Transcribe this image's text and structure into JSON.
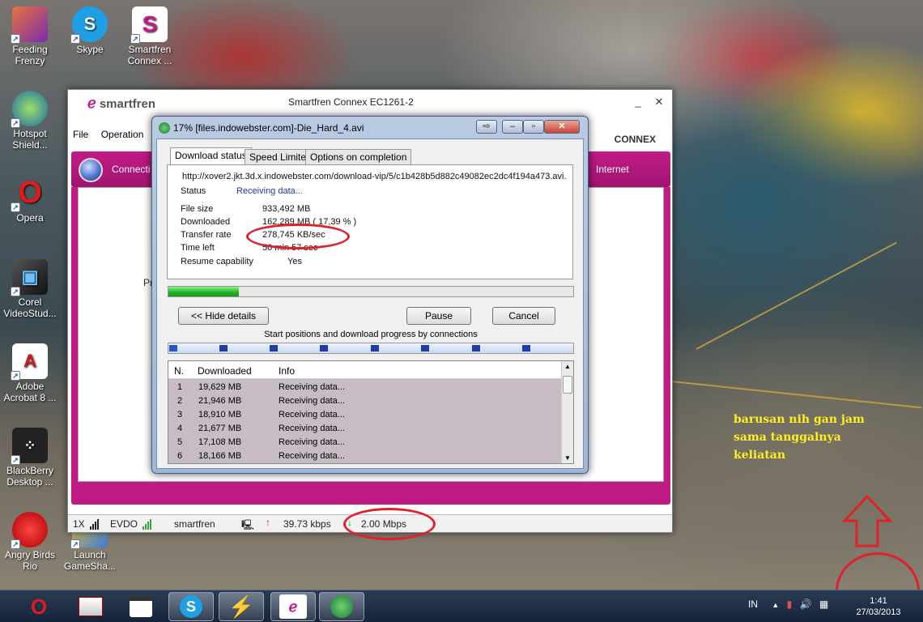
{
  "desktop": {
    "icons": [
      {
        "label": "Feeding Frenzy"
      },
      {
        "label": "Skype"
      },
      {
        "label": "Smartfren Connex ..."
      },
      {
        "label": "Hotspot Shield..."
      },
      {
        "label": "Opera"
      },
      {
        "label": "Corel VideoStud..."
      },
      {
        "label": "Adobe Acrobat 8 ..."
      },
      {
        "label": "BlackBerry Desktop ..."
      },
      {
        "label": "Angry Birds Rio"
      },
      {
        "label": "Launch GameSha..."
      }
    ],
    "annotation_lines": [
      "barusan nih gan jam",
      "sama tanggalnya",
      "keliatan"
    ],
    "colors": {
      "annotation": "#ffef22",
      "highlight_ring": "#e0202a"
    }
  },
  "smartfren_window": {
    "logo": "smartfren",
    "title": "Smartfren Connex EC1261-2",
    "menu": [
      "File",
      "Operation"
    ],
    "brand_right": "CONNEX",
    "nav_connect": "Connecti",
    "nav_internet": "Internet",
    "body_fragment": "Pr",
    "status_bar": {
      "network_mode": "1X",
      "technology": "EVDO",
      "operator": "smartfren",
      "upload_speed": "39.73 kbps",
      "download_speed": "2.00 Mbps"
    },
    "colors": {
      "brand": "#c21b86"
    }
  },
  "download_dialog": {
    "title": "17% [files.indowebster.com]-Die_Hard_4.avi",
    "tabs": [
      "Download status",
      "Speed Limiter",
      "Options on completion"
    ],
    "url": "http://xover2.jkt.3d.x.indowebster.com/download-vip/5/c1b428b5d882c49082ec2dc4f194a473.avi.",
    "fields": [
      {
        "label": "Status",
        "value": "Receiving data..."
      },
      {
        "label": "File size",
        "value": "933,492  MB"
      },
      {
        "label": "Downloaded",
        "value": "162,289  MB  ( 17,39 % )"
      },
      {
        "label": "Transfer rate",
        "value": "278,745  KB/sec"
      },
      {
        "label": "Time left",
        "value": "50 min 57 sec"
      },
      {
        "label": "Resume capability",
        "value": "Yes"
      }
    ],
    "progress_percent": 17.39,
    "buttons": {
      "hide_details": "<< Hide details",
      "pause": "Pause",
      "cancel": "Cancel"
    },
    "connections_label": "Start positions and download progress by connections",
    "list_headers": [
      "N.",
      "Downloaded",
      "Info"
    ],
    "connections": [
      {
        "n": "1",
        "downloaded": "19,629  MB",
        "info": "Receiving data..."
      },
      {
        "n": "2",
        "downloaded": "21,946  MB",
        "info": "Receiving data..."
      },
      {
        "n": "3",
        "downloaded": "18,910  MB",
        "info": "Receiving data..."
      },
      {
        "n": "4",
        "downloaded": "21,677  MB",
        "info": "Receiving data..."
      },
      {
        "n": "5",
        "downloaded": "17,108  MB",
        "info": "Receiving data..."
      },
      {
        "n": "6",
        "downloaded": "18,166  MB",
        "info": "Receiving data..."
      }
    ]
  },
  "taskbar": {
    "apps": [
      "opera-icon",
      "flash-cine-icon",
      "321-player-icon",
      "skype-icon",
      "winamp-icon",
      "smartfren-icon",
      "idm-icon"
    ],
    "tray_language": "IN",
    "clock_time": "1:41",
    "clock_date": "27/03/2013"
  }
}
